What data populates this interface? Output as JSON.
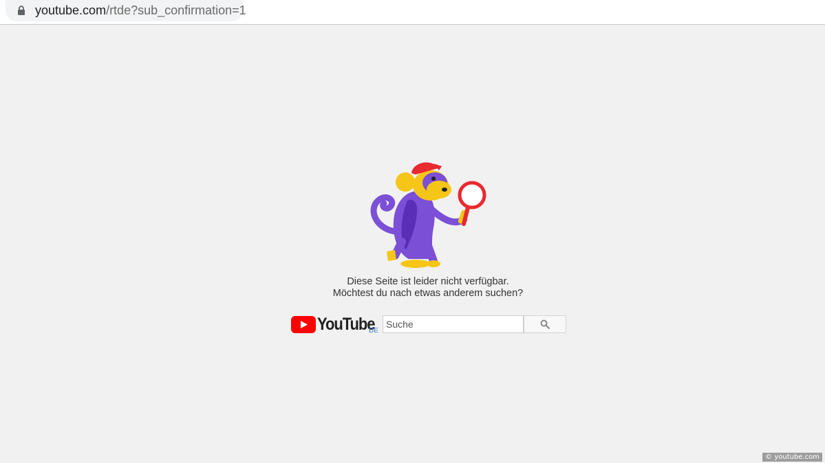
{
  "browser": {
    "url_domain": "youtube.com",
    "url_path": "/rtde?sub_confirmation=1"
  },
  "error": {
    "line1": "Diese Seite ist leider nicht verfügbar.",
    "line2": "Möchtest du nach etwas anderem suchen?"
  },
  "brand": {
    "wordmark": "YouTube",
    "country": "DE",
    "logo_color": "#ff0000"
  },
  "search": {
    "placeholder": "Suche",
    "value": ""
  },
  "credit": "© youtube.com",
  "icons": [
    "lock-icon",
    "monkey-illustration",
    "youtube-play-icon",
    "search-icon",
    "copyright-icon"
  ]
}
